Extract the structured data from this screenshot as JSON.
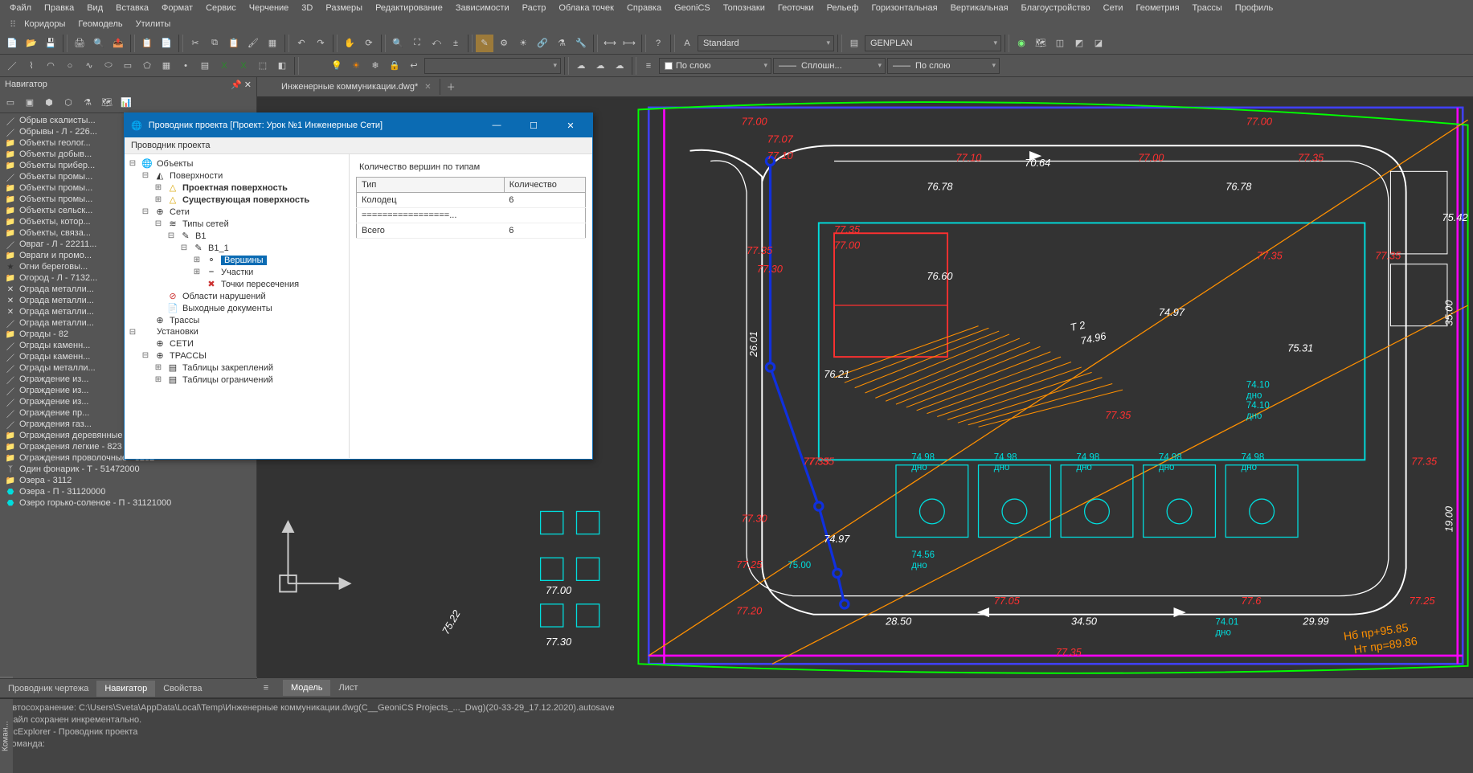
{
  "menu": [
    "Файл",
    "Правка",
    "Вид",
    "Вставка",
    "Формат",
    "Сервис",
    "Черчение",
    "3D",
    "Размеры",
    "Редактирование",
    "Зависимости",
    "Растр",
    "Облака точек",
    "Справка",
    "GeoniCS",
    "Топознаки",
    "Геоточки",
    "Рельеф",
    "Горизонтальная",
    "Вертикальная",
    "Благоустройство",
    "Сети",
    "Геометрия",
    "Трассы",
    "Профиль"
  ],
  "menu2": [
    "Коридоры",
    "Геомодель",
    "Утилиты"
  ],
  "combos": {
    "style": "Standard",
    "layer_name": "GENPLAN",
    "linetype1": "По слою",
    "linetype2": "Сплошн...",
    "linetype3": "По слою"
  },
  "navigator": {
    "title": "Навигатор"
  },
  "nav_items": [
    "Обрыв скалисты...",
    "Обрывы - Л - 226...",
    "Объекты геолог...",
    "Объекты добыв...",
    "Объекты прибер...",
    "Объекты промы...",
    "Объекты промы...",
    "Объекты промы...",
    "Объекты сельск...",
    "Объекты, котор...",
    "Объекты, связа...",
    "Овраг - Л - 22211...",
    "Овраги и промо...",
    "Огни береговы...",
    "Огород - Л - 7132...",
    "Ограда металли...",
    "Ограда металли...",
    "Ограда металли...",
    "Ограда металли...",
    "Ограды - 82",
    "Ограды каменн...",
    "Ограды каменн...",
    "Ограды металли...",
    "Ограждение из...",
    "Ограждение из...",
    "Ограждение из...",
    "Ограждение пр...",
    "Ограждения газ...",
    "Ограждения деревянные - 8231",
    "Ограждения легкие - 823",
    "Ограждения проволочные - 8232",
    "Один фонарик - Т - 51472000",
    "Озера - 3112",
    "Озера - П - 31120000",
    "Озеро горько-соленое - П - 31121000"
  ],
  "doc_tab": "Инженерные коммуникации.dwg*",
  "explorer": {
    "title": "Проводник проекта [Проект: Урок №1 Инженерные Сети]",
    "subtitle": "Проводник проекта",
    "root": "Объекты",
    "nodes": {
      "surfaces": "Поверхности",
      "proj_surf": "Проектная поверхность",
      "exist_surf": "Существующая поверхность",
      "nets": "Сети",
      "net_types": "Типы сетей",
      "b1": "В1",
      "b11": "В1_1",
      "verts": "Вершины",
      "sections": "Участки",
      "intersections": "Точки пересечения",
      "violations": "Области нарушений",
      "out_docs": "Выходные документы",
      "routes": "Трассы",
      "installs": "Установки",
      "seti": "СЕТИ",
      "trassy": "ТРАССЫ",
      "tab_fix": "Таблицы закреплений",
      "tab_lim": "Таблицы ограничений"
    },
    "grid": {
      "title": "Количество вершин по типам",
      "cols": [
        "Тип",
        "Количество"
      ],
      "rows": [
        [
          "Колодец",
          "6"
        ],
        [
          "=================...",
          ""
        ],
        [
          "Всего",
          "6"
        ]
      ]
    }
  },
  "bottom_left": [
    "Проводник чертежа",
    "Навигатор",
    "Свойства"
  ],
  "bottom_tabs": [
    "Модель",
    "Лист"
  ],
  "cmd_lines": [
    "Автосохранение: C:\\Users\\Sveta\\AppData\\Local\\Temp\\Инженерные коммуникации.dwg(C__GeoniCS Projects_..._Dwg)(20-33-29_17.12.2020).autosave",
    "Файл сохранен инкрементально.",
    "GcExplorer - Проводник проекта",
    "Команда:"
  ],
  "cmd_label": "Коман..."
}
